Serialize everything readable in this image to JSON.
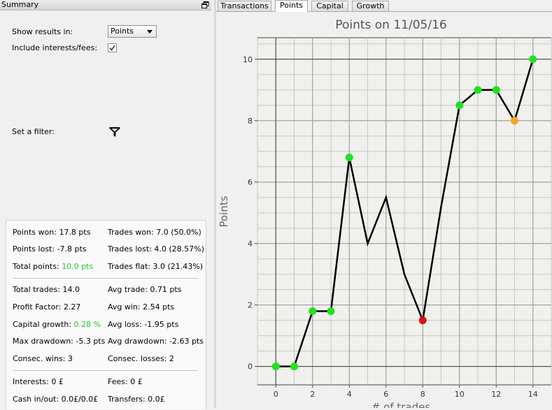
{
  "summary": {
    "title": "Summary",
    "show_results_label": "Show results in:",
    "show_results_value": "Points",
    "include_interests_label": "Include interests/fees:",
    "include_interests_checked": true,
    "filter_label": "Set a filter:",
    "stats": {
      "points_won": "Points won: 17.8 pts",
      "trades_won": "Trades won: 7.0 (50.0%)",
      "points_lost": "Points lost: -7.8 pts",
      "trades_lost": "Trades lost: 4.0 (28.57%)",
      "total_points_label": "Total points: ",
      "total_points_value": "10.0 pts",
      "trades_flat": "Trades flat: 3.0 (21.43%)",
      "total_trades": "Total trades: 14.0",
      "avg_trade": "Avg trade: 0.71 pts",
      "profit_factor": "Profit Factor: 2.27",
      "avg_win": "Avg win: 2.54 pts",
      "capital_growth_label": "Capital growth: ",
      "capital_growth_value": "0.28 %",
      "avg_loss": "Avg loss: -1.95 pts",
      "max_drawdown": "Max drawdown: -5.3 pts",
      "avg_drawdown": "Avg drawdown: -2.63 pts",
      "consec_wins": "Consec. wins: 3",
      "consec_losses": "Consec. losses: 2",
      "interests": "Interests: 0 £",
      "fees": "Fees: 0 £",
      "cash_in_out": "Cash in/out: 0.0£/0.0£",
      "transfers": "Transfers: 0.0£"
    }
  },
  "tabs": [
    {
      "label": "Transactions",
      "active": false
    },
    {
      "label": "Points",
      "active": true
    },
    {
      "label": "Capital",
      "active": false
    },
    {
      "label": "Growth",
      "active": false
    }
  ],
  "colors": {
    "accent_green": "#2bc22b",
    "marker_green": "#22e022",
    "marker_red": "#e01010",
    "marker_orange": "#f5a623",
    "line": "#000000"
  },
  "chart_data": {
    "type": "line",
    "title": "Points on 11/05/16",
    "xlabel": "# of trades",
    "ylabel": "Points",
    "xlim": [
      -1,
      15
    ],
    "ylim": [
      -0.6,
      10.7
    ],
    "xticks": [
      0,
      2,
      4,
      6,
      8,
      10,
      12,
      14
    ],
    "yticks": [
      0,
      2,
      4,
      6,
      8,
      10
    ],
    "grid": true,
    "series": [
      {
        "x": [
          0,
          1,
          2,
          3,
          4,
          5,
          6,
          7,
          8,
          9,
          10,
          11,
          12,
          13,
          14
        ],
        "y": [
          0,
          0,
          1.8,
          1.8,
          6.8,
          4.0,
          5.5,
          3.0,
          1.5,
          5.2,
          8.5,
          9.0,
          9.0,
          8.0,
          10.0
        ]
      }
    ],
    "markers": [
      {
        "x": 0,
        "y": 0,
        "color": "green"
      },
      {
        "x": 1,
        "y": 0,
        "color": "green"
      },
      {
        "x": 2,
        "y": 1.8,
        "color": "green"
      },
      {
        "x": 3,
        "y": 1.8,
        "color": "green"
      },
      {
        "x": 4,
        "y": 6.8,
        "color": "green"
      },
      {
        "x": 8,
        "y": 1.5,
        "color": "red"
      },
      {
        "x": 10,
        "y": 8.5,
        "color": "green"
      },
      {
        "x": 11,
        "y": 9.0,
        "color": "green"
      },
      {
        "x": 12,
        "y": 9.0,
        "color": "green"
      },
      {
        "x": 13,
        "y": 8.0,
        "color": "orange"
      },
      {
        "x": 14,
        "y": 10.0,
        "color": "green"
      }
    ]
  }
}
